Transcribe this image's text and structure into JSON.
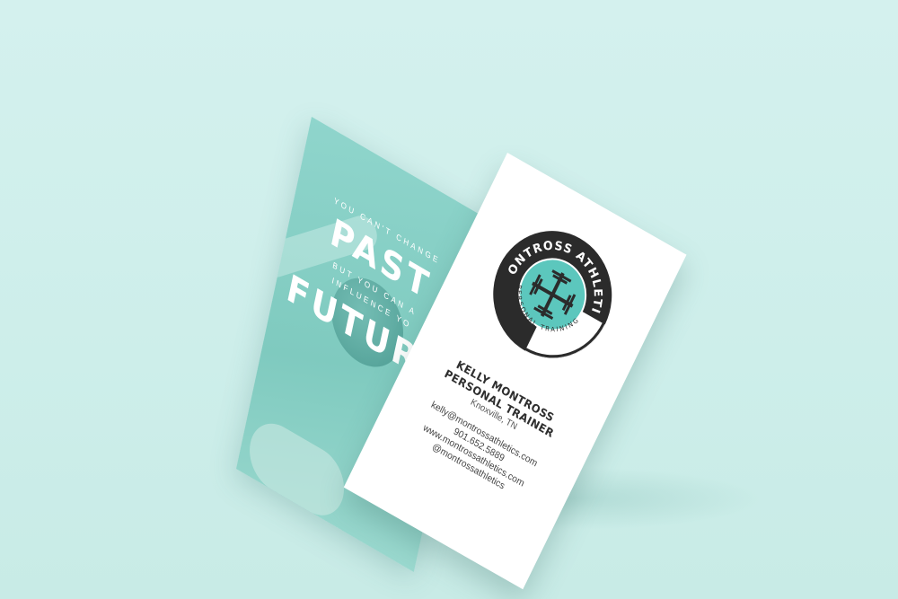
{
  "back_card": {
    "quote_line1": "YOU CAN'T CHANGE",
    "quote_big1": "PAST",
    "quote_line2": "BUT YOU CAN A",
    "quote_line3": "INFLUENCE YO",
    "quote_big2": "FUTURE"
  },
  "front_card": {
    "logo_name": "MONTROSS ATHLETICS",
    "logo_sub": "PERSONAL TRAINING",
    "name": "KELLY MONTROSS",
    "title": "PERSONAL TRAINER",
    "location": "Knoxville, TN",
    "email": "kelly@montrossathletics.com",
    "phone": "901.652.5889",
    "website": "www.montrossathletics.com",
    "handle": "@montrossathletics"
  },
  "colors": {
    "background": "#d4f1ee",
    "teal": "#5cc7bd",
    "dark": "#2b2b2b",
    "white": "#ffffff"
  }
}
